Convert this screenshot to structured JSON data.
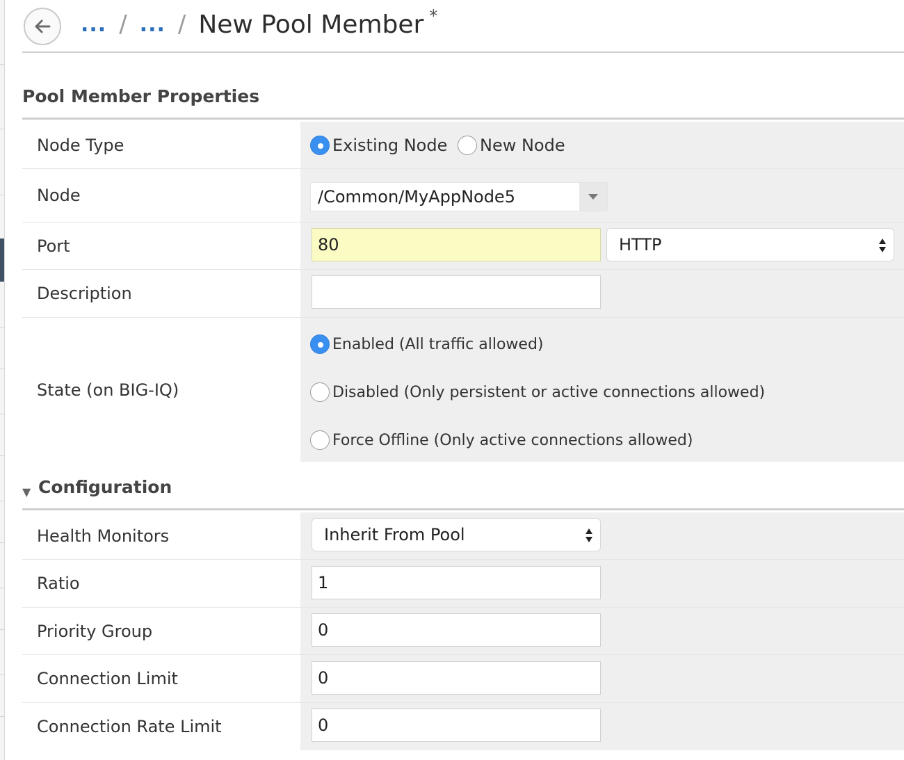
{
  "header": {
    "crumb_1": "...",
    "crumb_2": "...",
    "separator": "/",
    "title": "New Pool Member",
    "dirty_marker": "*"
  },
  "sections": {
    "properties_title": "Pool Member Properties",
    "configuration_title": "Configuration"
  },
  "properties": {
    "node_type": {
      "label": "Node Type",
      "options": [
        "Existing Node",
        "New Node"
      ],
      "selected": "Existing Node"
    },
    "node": {
      "label": "Node",
      "value": "/Common/MyAppNode5"
    },
    "port": {
      "label": "Port",
      "value": "80",
      "service": "HTTP"
    },
    "description": {
      "label": "Description",
      "value": ""
    },
    "state": {
      "label": "State (on BIG-IQ)",
      "options": [
        "Enabled (All traffic allowed)",
        "Disabled (Only persistent or active connections allowed)",
        "Force Offline (Only active connections allowed)"
      ],
      "selected": "Enabled (All traffic allowed)"
    }
  },
  "configuration": {
    "health_monitors": {
      "label": "Health Monitors",
      "value": "Inherit From Pool"
    },
    "ratio": {
      "label": "Ratio",
      "value": "1"
    },
    "priority_group": {
      "label": "Priority Group",
      "value": "0"
    },
    "connection_limit": {
      "label": "Connection Limit",
      "value": "0"
    },
    "connection_rate_limit": {
      "label": "Connection Rate Limit",
      "value": "0"
    }
  },
  "colors": {
    "accent_radio": "#3a90f0",
    "link": "#2a6ebb",
    "highlight_field": "#fbfbc4",
    "value_cell_bg": "#efefef"
  },
  "icons": {
    "back": "arrow-left-icon",
    "node_dropdown": "caret-down-icon",
    "select_arrows": "up-down-arrows-icon",
    "section_toggle": "caret-down-icon"
  }
}
